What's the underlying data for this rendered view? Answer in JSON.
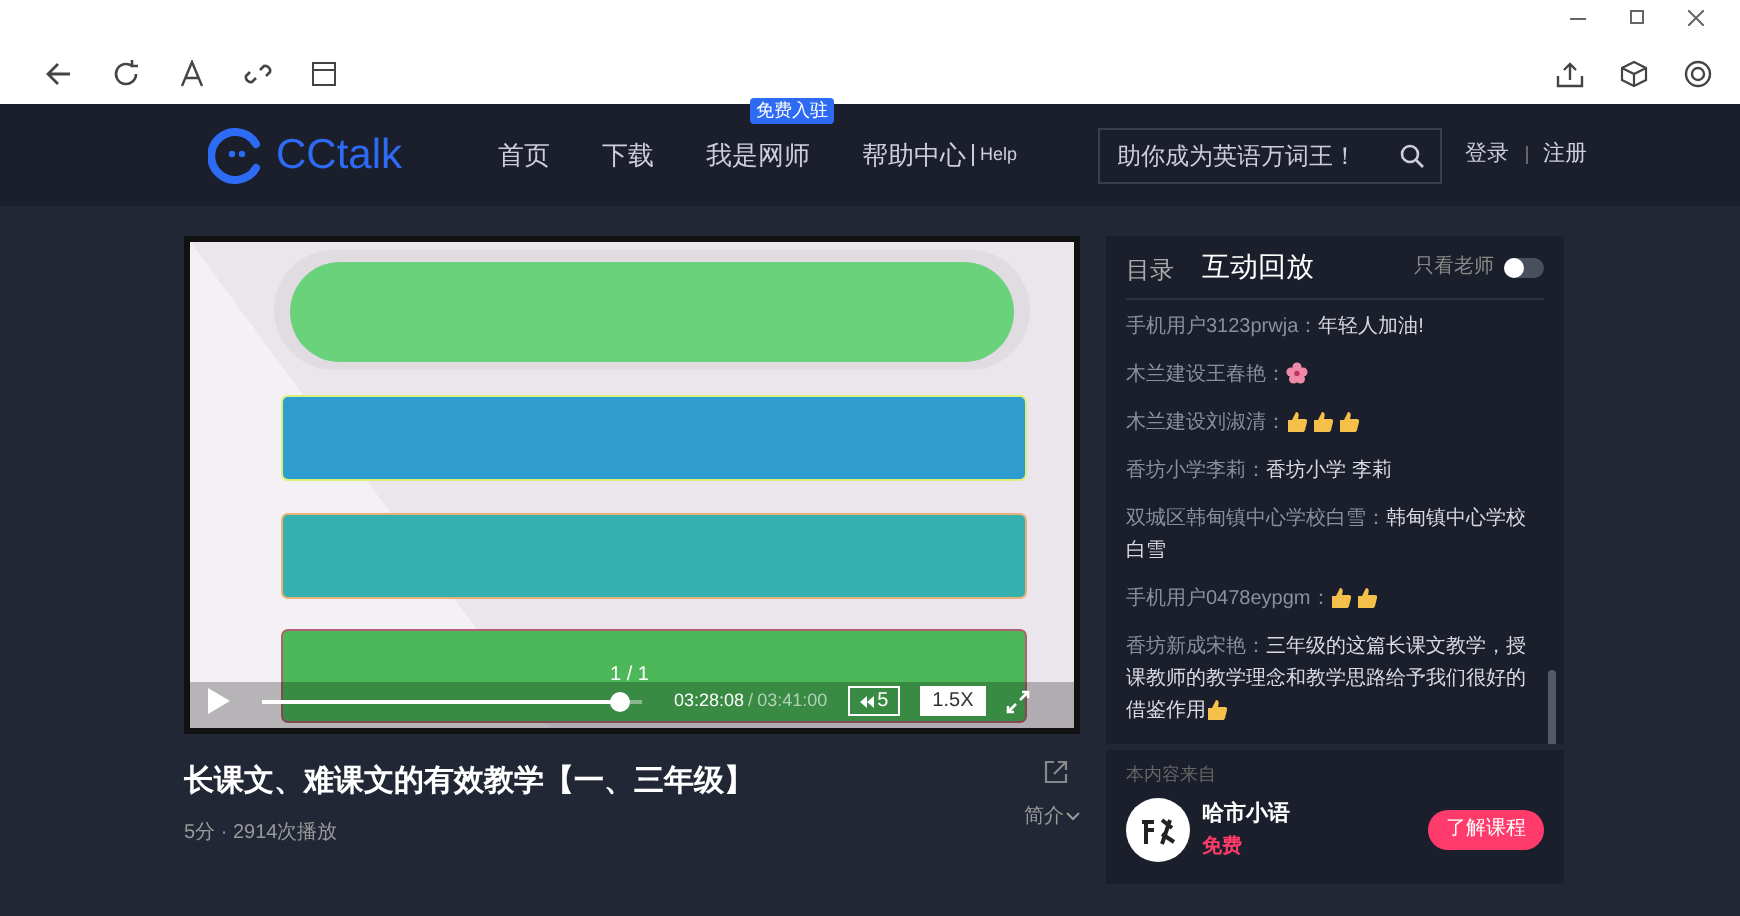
{
  "nav": {
    "logo": "CCtalk",
    "items": [
      {
        "label": "首页"
      },
      {
        "label": "下载"
      },
      {
        "label": "我是网师",
        "badge": "免费入驻"
      },
      {
        "label": "帮助中心",
        "sub": "Help"
      }
    ],
    "search": {
      "placeholder": "助你成为英语万词王！"
    },
    "auth": [
      "登录",
      "注册"
    ]
  },
  "video": {
    "page_indicator": "1 / 1",
    "time_current": "03:28:08",
    "time_separator": "/",
    "time_total": "03:41:00",
    "rewind": "5",
    "speed": "1.5X"
  },
  "course": {
    "title": "长课文、难课文的有效教学【一、三年级】",
    "meta": "5分 · 2914次播放",
    "intro": "简介"
  },
  "panel": {
    "tabs": [
      {
        "label": "目录",
        "selected": false
      },
      {
        "label": "互动回放",
        "selected": true
      }
    ],
    "teacher_only": {
      "label": "只看老师",
      "on": false
    },
    "messages": [
      {
        "user": "手机用户3123prwja：",
        "text": "年轻人加油!"
      },
      {
        "user": "木兰建设王春艳：",
        "icons": [
          {
            "kind": "flower"
          }
        ]
      },
      {
        "user": "木兰建设刘淑清：",
        "icons": [
          {
            "kind": "thumbs-up"
          },
          {
            "kind": "thumbs-up"
          },
          {
            "kind": "thumbs-up"
          }
        ]
      },
      {
        "user": "香坊小学李莉：",
        "text": "香坊小学 李莉"
      },
      {
        "user": "双城区韩甸镇中心学校白雪：",
        "text": "韩甸镇中心学校白雪"
      },
      {
        "user": "手机用户0478eypgm：",
        "icons": [
          {
            "kind": "thumbs-up"
          },
          {
            "kind": "thumbs-up"
          }
        ]
      },
      {
        "user": "香坊新成宋艳：",
        "text": "三年级的这篇长课文教学，授课教师的教学理念和教学思路给予我们很好的借鉴作用",
        "icons": [
          {
            "kind": "thumbs-up"
          }
        ]
      }
    ]
  },
  "source": {
    "label": "本内容来自",
    "name": "哈市小语",
    "price": "免费",
    "button": "了解课程"
  }
}
